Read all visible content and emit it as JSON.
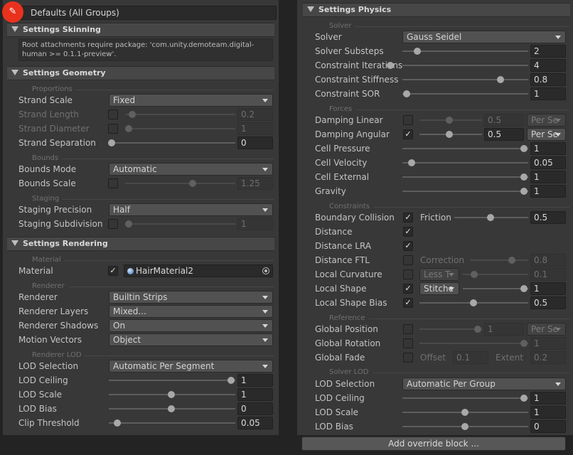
{
  "left": {
    "group_title": "Defaults (All Groups)",
    "skinning": {
      "title": "Settings Skinning",
      "note": "Root attachments require package: 'com.unity.demoteam.digital-human >= 0.1.1-preview'."
    },
    "geometry": {
      "title": "Settings Geometry",
      "proportions": "Proportions",
      "strand_scale": {
        "label": "Strand Scale",
        "value": "Fixed"
      },
      "strand_length": {
        "label": "Strand Length",
        "value": "0.2"
      },
      "strand_diameter": {
        "label": "Strand Diameter",
        "value": "1"
      },
      "strand_separation": {
        "label": "Strand Separation",
        "value": "0"
      },
      "bounds": "Bounds",
      "bounds_mode": {
        "label": "Bounds Mode",
        "value": "Automatic"
      },
      "bounds_scale": {
        "label": "Bounds Scale",
        "value": "1.25"
      },
      "staging": "Staging",
      "staging_precision": {
        "label": "Staging Precision",
        "value": "Half"
      },
      "staging_subdivision": {
        "label": "Staging Subdivision",
        "value": "1"
      }
    },
    "rendering": {
      "title": "Settings Rendering",
      "material_sub": "Material",
      "material": {
        "label": "Material",
        "value": "HairMaterial2"
      },
      "renderer_sub": "Renderer",
      "renderer": {
        "label": "Renderer",
        "value": "Builtin Strips"
      },
      "renderer_layers": {
        "label": "Renderer Layers",
        "value": "Mixed..."
      },
      "renderer_shadows": {
        "label": "Renderer Shadows",
        "value": "On"
      },
      "motion_vectors": {
        "label": "Motion Vectors",
        "value": "Object"
      },
      "lod_sub": "Renderer LOD",
      "lod_selection": {
        "label": "LOD Selection",
        "value": "Automatic Per Segment"
      },
      "lod_ceiling": {
        "label": "LOD Ceiling",
        "value": "1"
      },
      "lod_scale": {
        "label": "LOD Scale",
        "value": "1"
      },
      "lod_bias": {
        "label": "LOD Bias",
        "value": "0"
      },
      "clip_threshold": {
        "label": "Clip Threshold",
        "value": "0.05"
      }
    }
  },
  "right": {
    "physics_title": "Settings Physics",
    "solver_sub": "Solver",
    "solver": {
      "label": "Solver",
      "value": "Gauss Seidel"
    },
    "solver_substeps": {
      "label": "Solver Substeps",
      "value": "2"
    },
    "constraint_iterations": {
      "label": "Constraint Iterations",
      "value": "4"
    },
    "constraint_stiffness": {
      "label": "Constraint Stiffness",
      "value": "0.8"
    },
    "constraint_sor": {
      "label": "Constraint SOR",
      "value": "1"
    },
    "forces_sub": "Forces",
    "damping_linear": {
      "label": "Damping Linear",
      "value": "0.5",
      "unit": "Per Se"
    },
    "damping_angular": {
      "label": "Damping Angular",
      "value": "0.5",
      "unit": "Per Se"
    },
    "cell_pressure": {
      "label": "Cell Pressure",
      "value": "1"
    },
    "cell_velocity": {
      "label": "Cell Velocity",
      "value": "0.05"
    },
    "cell_external": {
      "label": "Cell External",
      "value": "1"
    },
    "gravity": {
      "label": "Gravity",
      "value": "1"
    },
    "constraints_sub": "Constraints",
    "boundary_collision": {
      "label": "Boundary Collision",
      "inner_label": "Friction",
      "value": "0.5"
    },
    "distance": {
      "label": "Distance"
    },
    "distance_lra": {
      "label": "Distance LRA"
    },
    "distance_ftl": {
      "label": "Distance FTL",
      "inner_label": "Correction",
      "value": "0.8"
    },
    "local_curvature": {
      "label": "Local Curvature",
      "mode": "Less T",
      "value": "0.1"
    },
    "local_shape": {
      "label": "Local Shape",
      "mode": "Stitche",
      "value": "1"
    },
    "local_shape_bias": {
      "label": "Local Shape Bias",
      "value": "0.5"
    },
    "reference_sub": "Reference",
    "global_position": {
      "label": "Global Position",
      "value": "1",
      "unit": "Per Se"
    },
    "global_rotation": {
      "label": "Global Rotation",
      "value": "1"
    },
    "global_fade": {
      "label": "Global Fade",
      "offset_label": "Offset",
      "offset": "0.1",
      "extent_label": "Extent",
      "extent": "0.2"
    },
    "solver_lod_sub": "Solver LOD",
    "lod_selection": {
      "label": "LOD Selection",
      "value": "Automatic Per Group"
    },
    "lod_ceiling": {
      "label": "LOD Ceiling",
      "value": "1"
    },
    "lod_scale": {
      "label": "LOD Scale",
      "value": "1"
    },
    "lod_bias": {
      "label": "LOD Bias",
      "value": "0"
    },
    "add_override": "Add override block ..."
  },
  "icons": {
    "edit": "pencil-icon",
    "foldout": "triangle-down-icon",
    "object_picker": "target-circle-icon",
    "material": "sphere-icon",
    "checkmark": "check-icon"
  },
  "colors": {
    "highlight": "#e8321e",
    "panel": "#383838",
    "header": "#474747",
    "field": "#2a2a2a"
  }
}
